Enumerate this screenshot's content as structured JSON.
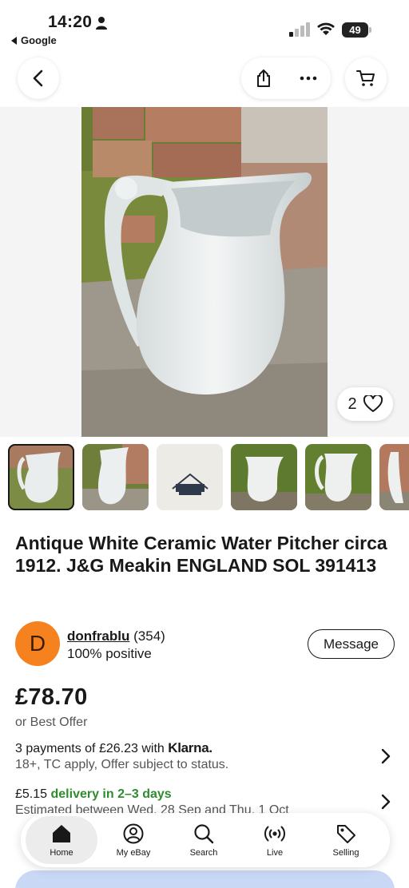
{
  "status_bar": {
    "time": "14:20",
    "back_app": "Google",
    "battery": "49"
  },
  "nav": {
    "icons": [
      "back-arrow-icon",
      "share-icon",
      "more-icon",
      "cart-icon"
    ]
  },
  "hero": {
    "watch_count": "2"
  },
  "thumbnails": [
    "pitcher-front",
    "pitcher-side",
    "base-stamp",
    "pitcher-garden",
    "pitcher-garden-2",
    "pitcher-partial"
  ],
  "listing": {
    "title": "Antique White Ceramic Water Pitcher circa 1912. J&G Meakin ENGLAND SOL 391413",
    "seller_initial": "D",
    "seller_name": "donfrablu",
    "seller_score": "(354)",
    "seller_feedback": "100% positive",
    "message_label": "Message",
    "price": "£78.70",
    "best_offer": "or Best Offer",
    "klarna_prefix": "3 payments of £26.23 with",
    "klarna_brand": "Klarna.",
    "klarna_terms": "18+, TC apply, Offer subject to status.",
    "delivery_price": "£5.15",
    "delivery_speed": "delivery in 2–3 days",
    "delivery_estimate": "Estimated between Wed, 28 Sep and Thu, 1 Oct"
  },
  "tabbar": {
    "items": [
      {
        "label": "Home",
        "icon": "home-icon"
      },
      {
        "label": "My eBay",
        "icon": "profile-icon"
      },
      {
        "label": "Search",
        "icon": "search-icon"
      },
      {
        "label": "Live",
        "icon": "live-icon"
      },
      {
        "label": "Selling",
        "icon": "tag-icon"
      }
    ]
  },
  "colors": {
    "accent": "#3665f3",
    "avatar": "#f5821f",
    "delivery_green": "#2e8b2e",
    "buy_button": "#c9d8f5"
  }
}
